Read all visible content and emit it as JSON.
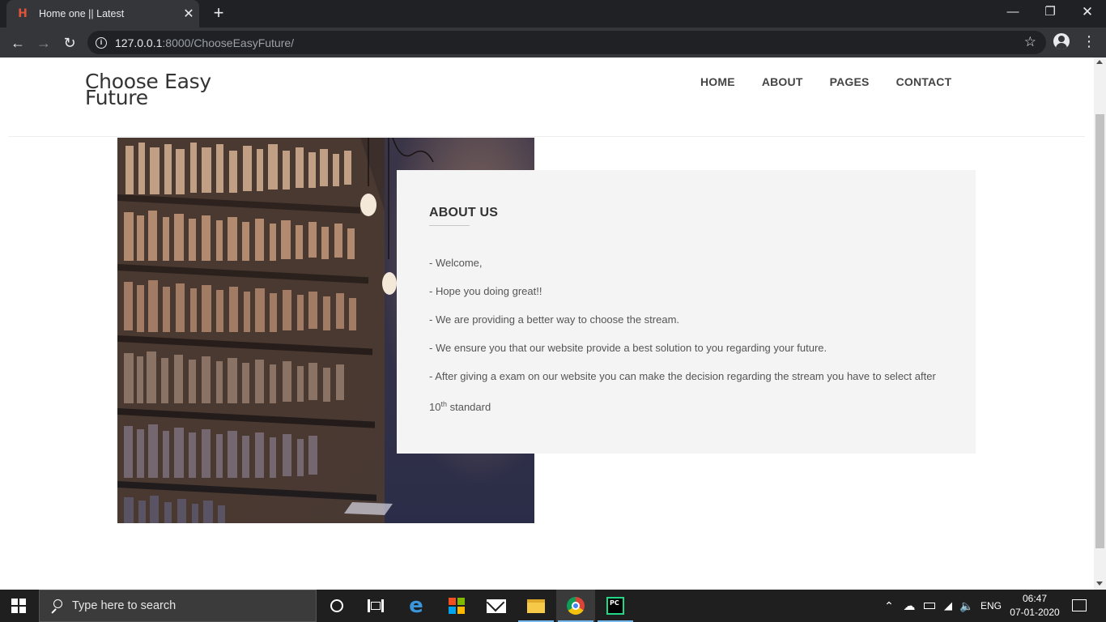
{
  "browser": {
    "tab_title": "Home one || Latest",
    "url_host": "127.0.0.1",
    "url_path": ":8000/ChooseEasyFuture/"
  },
  "site": {
    "brand_line1": "Choose Easy",
    "brand_line2": "Future",
    "nav": [
      "HOME",
      "ABOUT",
      "PAGES",
      "CONTACT"
    ]
  },
  "about": {
    "title": "ABOUT US",
    "lines": [
      "- Welcome,",
      "- Hope you doing great!!",
      "- We are providing a better way to choose the stream.",
      "- We ensure you that our website provide a best solution to you regarding your future.",
      "- After giving a exam on our website you can make the decision regarding the stream you have to select after"
    ],
    "last_prefix": "10",
    "last_sup": "th",
    "last_suffix": " standard"
  },
  "taskbar": {
    "search_placeholder": "Type here to search",
    "language": "ENG",
    "time": "06:47",
    "date": "07-01-2020"
  }
}
